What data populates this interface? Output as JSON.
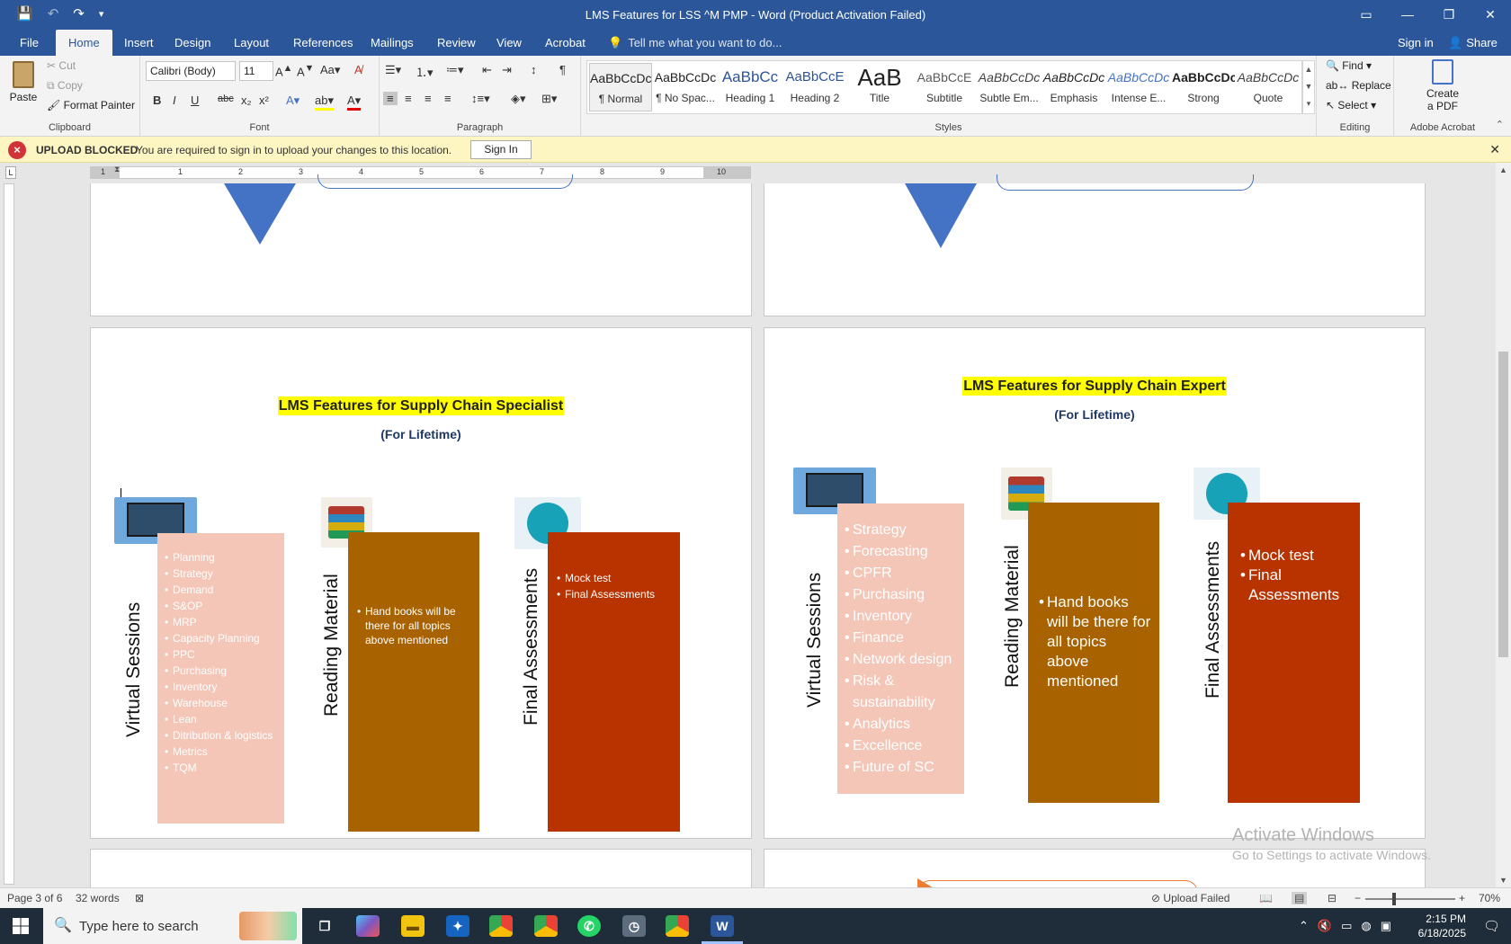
{
  "titlebar": {
    "title": "LMS Features for LSS ^M PMP  -  Word (Product Activation Failed)",
    "save_icon": "💾",
    "undo_icon": "↶",
    "redo_icon": "↷",
    "customize_icon": "▾",
    "restore_ribbon_icon": "▭",
    "minimize_icon": "—",
    "maximize_icon": "❐",
    "close_icon": "✕"
  },
  "tabs": {
    "file": "File",
    "home": "Home",
    "insert": "Insert",
    "design": "Design",
    "layout": "Layout",
    "references": "References",
    "mailings": "Mailings",
    "review": "Review",
    "view": "View",
    "acrobat": "Acrobat",
    "tell_me": "Tell me what you want to do...",
    "sign_in": "Sign in",
    "share": "Share"
  },
  "ribbon": {
    "clipboard": {
      "label": "Clipboard",
      "paste": "Paste",
      "cut": "Cut",
      "copy": "Copy",
      "format_painter": "Format Painter"
    },
    "font": {
      "label": "Font",
      "font_name": "Calibri (Body)",
      "font_size": "11"
    },
    "paragraph": {
      "label": "Paragraph"
    },
    "styles": {
      "label": "Styles",
      "items": [
        {
          "preview": "AaBbCcDc",
          "name": "¶ Normal"
        },
        {
          "preview": "AaBbCcDc",
          "name": "¶ No Spac..."
        },
        {
          "preview": "AaBbCc",
          "name": "Heading 1"
        },
        {
          "preview": "AaBbCcE",
          "name": "Heading 2"
        },
        {
          "preview": "AaB",
          "name": "Title"
        },
        {
          "preview": "AaBbCcE",
          "name": "Subtitle"
        },
        {
          "preview": "AaBbCcDc",
          "name": "Subtle Em..."
        },
        {
          "preview": "AaBbCcDc",
          "name": "Emphasis"
        },
        {
          "preview": "AaBbCcDc",
          "name": "Intense E..."
        },
        {
          "preview": "AaBbCcDc",
          "name": "Strong"
        },
        {
          "preview": "AaBbCcDc",
          "name": "Quote"
        }
      ]
    },
    "editing": {
      "label": "Editing",
      "find": "Find",
      "replace": "Replace",
      "select": "Select"
    },
    "acrobat": {
      "label": "Adobe Acrobat",
      "create_pdf_line1": "Create",
      "create_pdf_line2": "a PDF"
    }
  },
  "message_bar": {
    "title": "UPLOAD BLOCKED",
    "text": "You are required to sign in to upload your changes to this location.",
    "button": "Sign In"
  },
  "ruler_numbers": [
    "1",
    "1",
    "2",
    "3",
    "4",
    "5",
    "6",
    "7",
    "8",
    "9",
    "10"
  ],
  "page_left": {
    "title": "LMS Features for Supply Chain Specialist",
    "subtitle": "(For Lifetime)",
    "col1_label": "Virtual Sessions",
    "col1_items": [
      "Planning",
      "Strategy",
      "Demand",
      "S&OP",
      "MRP",
      "Capacity Planning",
      "PPC",
      "Purchasing",
      "Inventory",
      "Warehouse",
      "Lean",
      "Ditribution & logistics",
      "Metrics",
      "TQM"
    ],
    "col2_label": "Reading Material",
    "col2_items": [
      "Hand books will be there for all topics above mentioned"
    ],
    "col3_label": "Final Assessments",
    "col3_items": [
      "Mock test",
      "Final Assessments"
    ]
  },
  "page_right": {
    "title": "LMS Features for Supply Chain Expert",
    "subtitle": "(For Lifetime)",
    "col1_label": "Virtual Sessions",
    "col1_items": [
      "Strategy",
      "Forecasting",
      " CPFR",
      "Purchasing",
      "Inventory",
      "Finance",
      "Network design",
      "Risk & sustainability",
      "Analytics",
      "Excellence",
      "Future of SC"
    ],
    "col2_label": "Reading Material",
    "col2_items": [
      "Hand books will be there for all topics above mentioned"
    ],
    "col3_label": "Final Assessments",
    "col3_items": [
      "Mock test",
      "Final Assessments"
    ]
  },
  "watermark": {
    "line1": "Activate Windows",
    "line2": "Go to Settings to activate Windows."
  },
  "statusbar": {
    "page": "Page 3 of 6",
    "words": "32 words",
    "upload": "Upload Failed",
    "zoom": "70%"
  },
  "taskbar": {
    "search_placeholder": "Type here to search",
    "time": "2:15 PM",
    "date": "6/18/2025"
  },
  "colors": {
    "accent": "#2b579a",
    "peach": "#f4c6b8",
    "brown": "#a86200",
    "rust": "#b83300",
    "chevron": "#4472c4",
    "highlight": "#ffff00"
  }
}
